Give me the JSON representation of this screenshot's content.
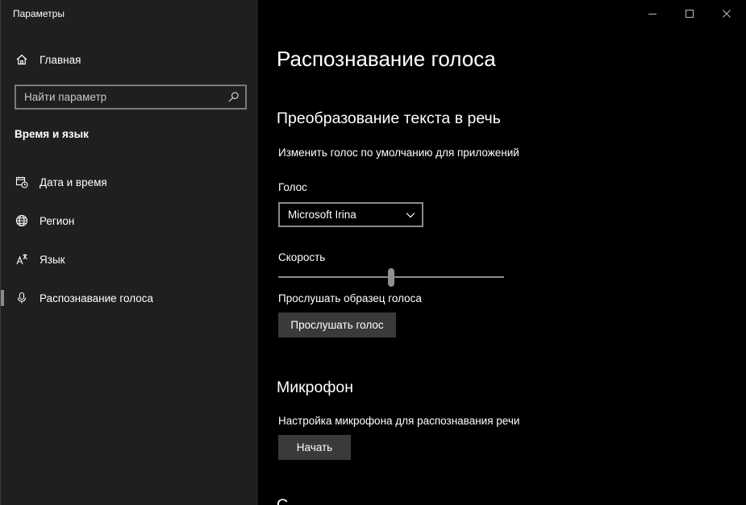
{
  "window": {
    "title": "Параметры"
  },
  "sidebar": {
    "home_label": "Главная",
    "search_placeholder": "Найти параметр",
    "section_title": "Время и язык",
    "items": [
      {
        "label": "Дата и время",
        "icon": "calendar-clock-icon"
      },
      {
        "label": "Регион",
        "icon": "globe-icon"
      },
      {
        "label": "Язык",
        "icon": "language-icon"
      },
      {
        "label": "Распознавание голоса",
        "icon": "microphone-icon",
        "active": true
      }
    ]
  },
  "main": {
    "title": "Распознавание голоса",
    "tts": {
      "heading": "Преобразование текста в речь",
      "description": "Изменить голос по умолчанию для приложений",
      "voice_label": "Голос",
      "voice_value": "Microsoft Irina",
      "speed_label": "Скорость",
      "speed_level": 0.5,
      "preview_label": "Прослушать образец голоса",
      "preview_button": "Прослушать голос"
    },
    "mic": {
      "heading": "Микрофон",
      "description": "Настройка микрофона для распознавания речи",
      "start_button": "Начать"
    },
    "next_heading_partial": "С"
  },
  "colors": {
    "sidebar_bg": "#1f1f1f",
    "content_bg": "#000000",
    "button_bg": "#3a3a3a",
    "accent_bar": "#8a8a8a"
  }
}
